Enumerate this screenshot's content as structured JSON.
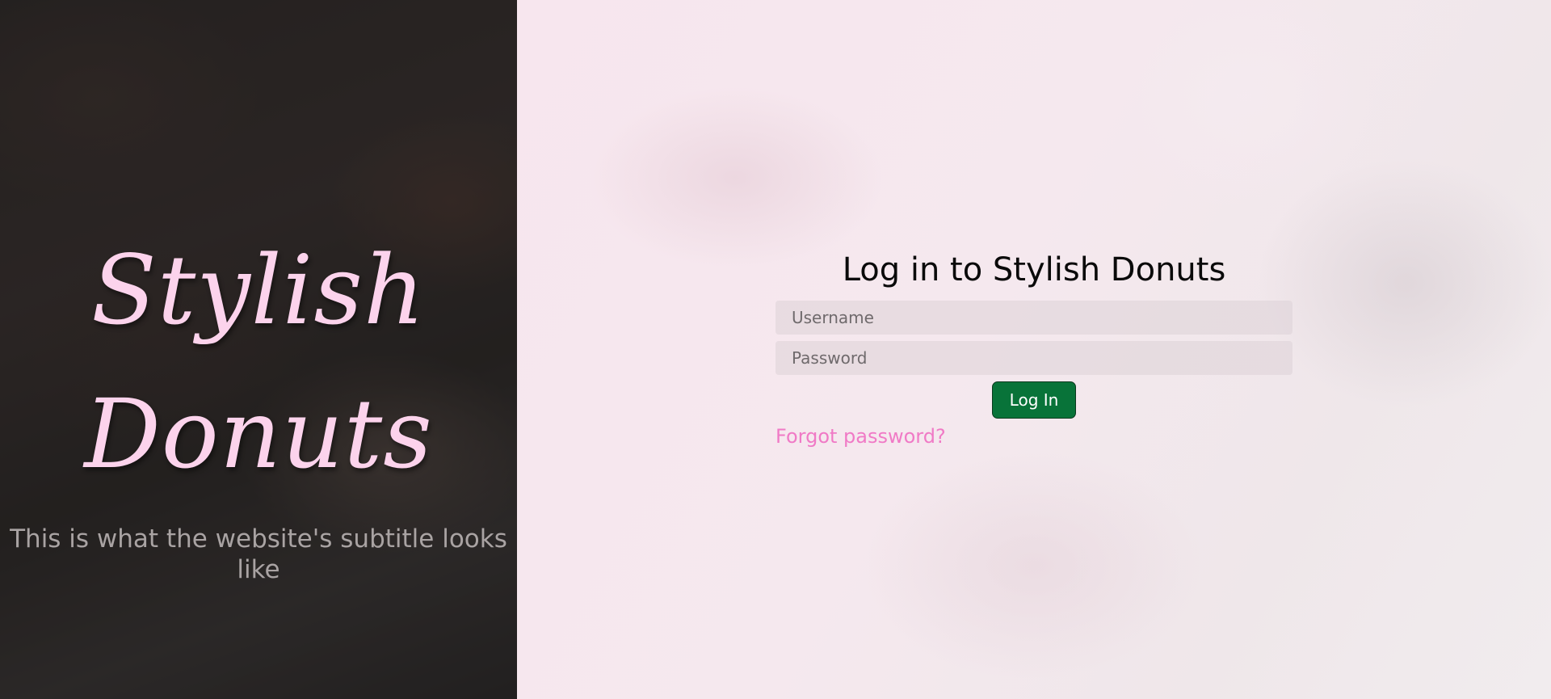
{
  "hero": {
    "title_line1": "Stylish",
    "title_line2": "Donuts",
    "subtitle": "This is what the website's subtitle looks like"
  },
  "login": {
    "heading": "Log in to Stylish Donuts",
    "username_placeholder": "Username",
    "password_placeholder": "Password",
    "submit_label": "Log In",
    "forgot_link": "Forgot password?"
  },
  "colors": {
    "title_pink": "#fcd3ec",
    "button_green": "#087339",
    "link_pink": "#f07ac6"
  }
}
